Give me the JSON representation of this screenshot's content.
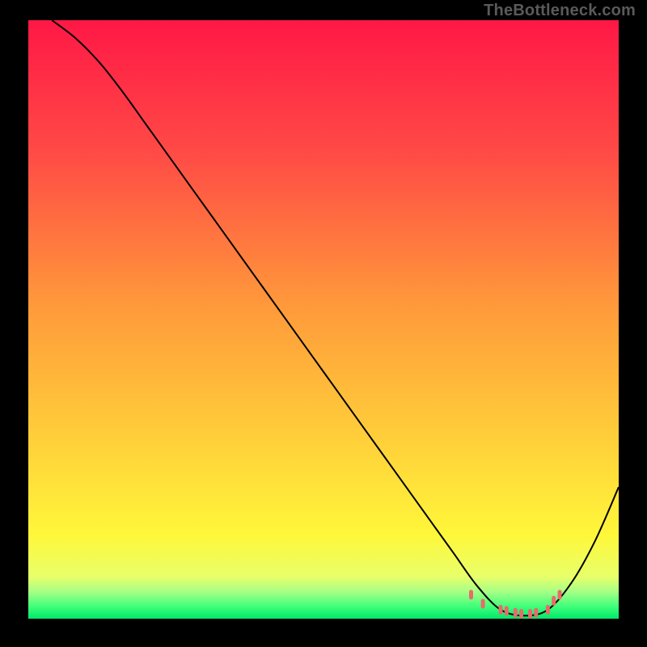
{
  "watermark": "TheBottleneck.com",
  "chart_data": {
    "type": "line",
    "title": "",
    "xlabel": "",
    "ylabel": "",
    "xlim": [
      0,
      100
    ],
    "ylim": [
      0,
      100
    ],
    "series": [
      {
        "name": "curve",
        "x": [
          4,
          8,
          12,
          16,
          20,
          24,
          28,
          32,
          36,
          40,
          44,
          48,
          52,
          56,
          60,
          64,
          68,
          72,
          76,
          80,
          84,
          88,
          92,
          96,
          100
        ],
        "y": [
          100,
          97,
          93,
          88,
          82.5,
          77,
          71.5,
          66,
          60.5,
          55,
          49.5,
          44,
          38.5,
          33,
          27.5,
          22,
          16.5,
          11,
          5.5,
          1.5,
          0.5,
          1.5,
          6,
          13,
          22
        ],
        "color": "#000000"
      }
    ],
    "markers": [
      {
        "x": 75,
        "y": 4
      },
      {
        "x": 77,
        "y": 2.5
      },
      {
        "x": 80,
        "y": 1.5
      },
      {
        "x": 81,
        "y": 1.3
      },
      {
        "x": 82.5,
        "y": 1.0
      },
      {
        "x": 83.5,
        "y": 0.8
      },
      {
        "x": 85,
        "y": 0.8
      },
      {
        "x": 86,
        "y": 1.0
      },
      {
        "x": 88,
        "y": 1.5
      },
      {
        "x": 89,
        "y": 3
      },
      {
        "x": 90,
        "y": 4
      }
    ],
    "marker_color": "#e96a6a",
    "gradient_stops": [
      {
        "offset": 0.0,
        "color": "#ff1846"
      },
      {
        "offset": 0.22,
        "color": "#ff4a46"
      },
      {
        "offset": 0.48,
        "color": "#ff9a3a"
      },
      {
        "offset": 0.72,
        "color": "#ffd43a"
      },
      {
        "offset": 0.86,
        "color": "#fff73a"
      },
      {
        "offset": 0.93,
        "color": "#e8ff6a"
      },
      {
        "offset": 0.955,
        "color": "#a6ff86"
      },
      {
        "offset": 0.98,
        "color": "#3eff7a"
      },
      {
        "offset": 1.0,
        "color": "#00e86a"
      }
    ]
  }
}
